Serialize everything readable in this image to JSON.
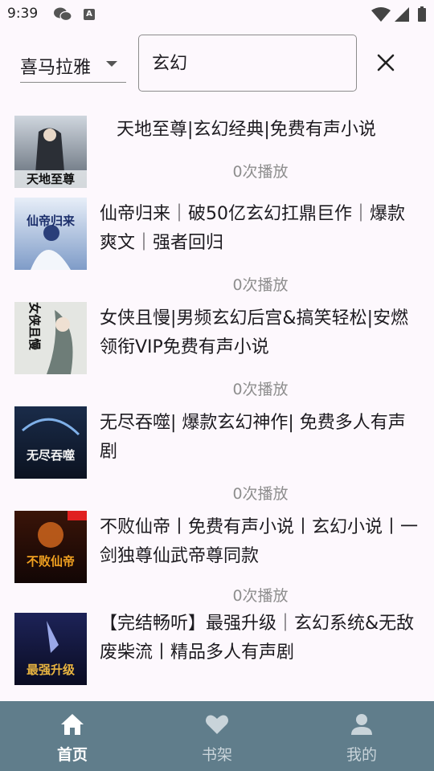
{
  "status_bar": {
    "time": "9:39",
    "icons": [
      "wechat-icon",
      "accessibility-a-icon",
      "wifi-icon",
      "signal-icon",
      "battery-icon"
    ]
  },
  "search": {
    "source": "喜马拉雅",
    "query": "玄幻"
  },
  "results": [
    {
      "title": "天地至尊|玄幻经典|免费有声小说",
      "plays": "0次播放",
      "cover_text": "天地至尊"
    },
    {
      "title": "仙帝归来｜破50亿玄幻扛鼎巨作｜爆款爽文｜强者回归",
      "plays": "0次播放",
      "cover_text": "仙帝归来"
    },
    {
      "title": "女侠且慢|男频玄幻后宫&搞笑轻松|安燃领衔VIP免费有声小说",
      "plays": "0次播放",
      "cover_text": "女侠且慢"
    },
    {
      "title": "无尽吞噬| 爆款玄幻神作| 免费多人有声剧",
      "plays": "0次播放",
      "cover_text": "无尽吞噬"
    },
    {
      "title": "不败仙帝丨免费有声小说丨玄幻小说丨一剑独尊仙武帝尊同款",
      "plays": "0次播放",
      "cover_text": "不败仙帝"
    },
    {
      "title": "【完结畅听】最强升级｜玄幻系统&无敌废柴流丨精品多人有声剧",
      "plays": "",
      "cover_text": "最强升级"
    }
  ],
  "nav": {
    "home": "首页",
    "shelf": "书架",
    "mine": "我的"
  },
  "colors": {
    "nav_bg": "#607d8b",
    "page_bg": "#fdf8fd",
    "muted_text": "#8e8e8e"
  }
}
